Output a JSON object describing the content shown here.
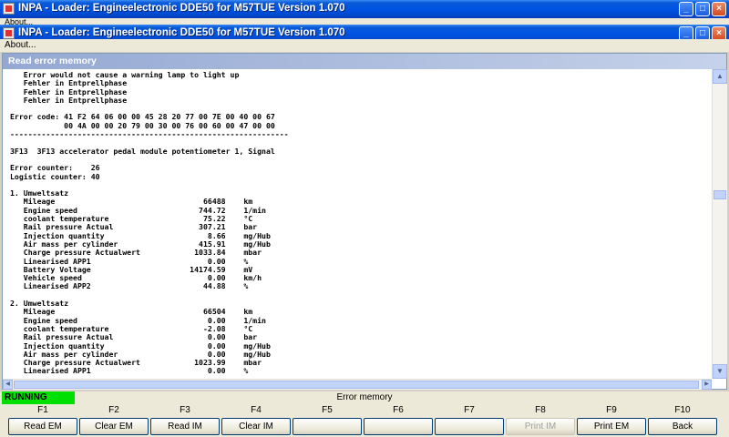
{
  "windows": {
    "outer_title": "INPA - Loader:  Engineelectronic DDE50 for M57TUE Version 1.070",
    "outer_menu": "About...",
    "inner_title": "INPA - Loader:  Engineelectronic DDE50 for M57TUE Version 1.070",
    "inner_menu": "About..."
  },
  "panel": {
    "title": "Read error memory",
    "lines": [
      "   Error would not cause a warning lamp to light up",
      "   Fehler in Entprellphase",
      "   Fehler in Entprellphase",
      "   Fehler in Entprellphase",
      "",
      "Error code: 41 F2 64 06 00 00 45 28 20 77 00 7E 00 40 00 67",
      "            00 4A 00 00 20 79 00 30 00 76 00 60 00 47 00 00",
      "--------------------------------------------------------------",
      "",
      "3F13  3F13 accelerator pedal module potentiometer 1, Signal",
      "",
      "Error counter:    26",
      "Logistic counter: 40",
      "",
      "1. Umweltsatz",
      "   Mileage                                 66488    km",
      "   Engine speed                           744.72    1/min",
      "   coolant temperature                     75.22    °C",
      "   Rail pressure Actual                   307.21    bar",
      "   Injection quantity                       8.66    mg/Hub",
      "   Air mass per cylinder                  415.91    mg/Hub",
      "   Charge pressure Actualwert            1033.84    mbar",
      "   Linearised APP1                          0.00    %",
      "   Battery Voltage                      14174.59    mV",
      "   Vehicle speed                            0.00    km/h",
      "   Linearised APP2                         44.88    %",
      "",
      "2. Umweltsatz",
      "   Mileage                                 66504    km",
      "   Engine speed                             0.00    1/min",
      "   coolant temperature                     -2.08    °C",
      "   Rail pressure Actual                     0.00    bar",
      "   Injection quantity                       0.00    mg/Hub",
      "   Air mass per cylinder                    0.00    mg/Hub",
      "   Charge pressure Actualwert            1023.99    mbar",
      "   Linearised APP1                          0.00    %"
    ]
  },
  "status": {
    "state": "RUNNING",
    "state_color": "#00e000",
    "screen_title": "Error memory"
  },
  "function_keys": [
    {
      "key": "F1",
      "label": "Read EM",
      "enabled": true
    },
    {
      "key": "F2",
      "label": "Clear EM",
      "enabled": true
    },
    {
      "key": "F3",
      "label": "Read IM",
      "enabled": true
    },
    {
      "key": "F4",
      "label": "Clear IM",
      "enabled": true
    },
    {
      "key": "F5",
      "label": "",
      "enabled": true
    },
    {
      "key": "F6",
      "label": "",
      "enabled": true
    },
    {
      "key": "F7",
      "label": "",
      "enabled": true
    },
    {
      "key": "F8",
      "label": "Print IM",
      "enabled": false
    },
    {
      "key": "F9",
      "label": "Print EM",
      "enabled": true
    },
    {
      "key": "F10",
      "label": "Back",
      "enabled": true
    }
  ]
}
